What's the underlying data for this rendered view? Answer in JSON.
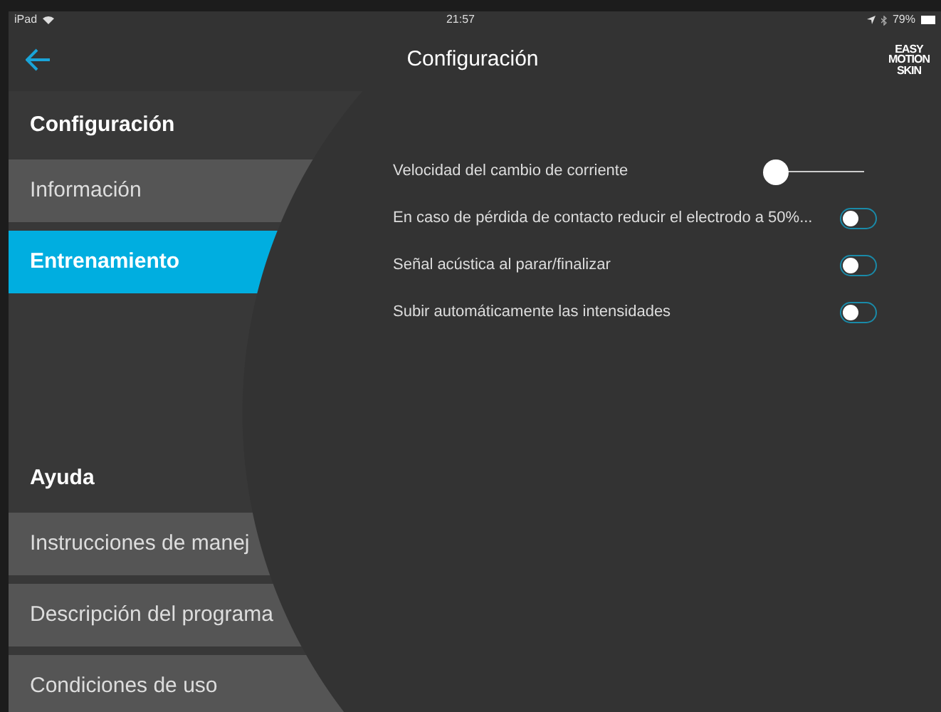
{
  "status_bar": {
    "device": "iPad",
    "time": "21:57",
    "battery": "79%"
  },
  "nav_bar": {
    "title": "Configuración",
    "logo": [
      "EASY",
      "MOTION",
      "SKIN"
    ]
  },
  "sidebar": {
    "sections": [
      {
        "title": "Configuración",
        "items": [
          {
            "label": "Información",
            "selected": false
          },
          {
            "label": "Entrenamiento",
            "selected": true
          }
        ]
      },
      {
        "title": "Ayuda",
        "items": [
          {
            "label": "Instrucciones de manej",
            "selected": false
          },
          {
            "label": "Descripción del programa",
            "selected": false
          },
          {
            "label": "Condiciones de uso",
            "selected": false
          }
        ]
      }
    ]
  },
  "settings": [
    {
      "kind": "slider",
      "label": "Velocidad del cambio de corriente",
      "level": 0
    },
    {
      "kind": "toggle",
      "label": "En caso de pérdida de contacto reducir el electrodo a 50%...",
      "on": false
    },
    {
      "kind": "toggle",
      "label": "Señal acústica al parar/finalizar",
      "on": false
    },
    {
      "kind": "toggle",
      "label": "Subir automáticamente las intensidades",
      "on": false
    }
  ]
}
